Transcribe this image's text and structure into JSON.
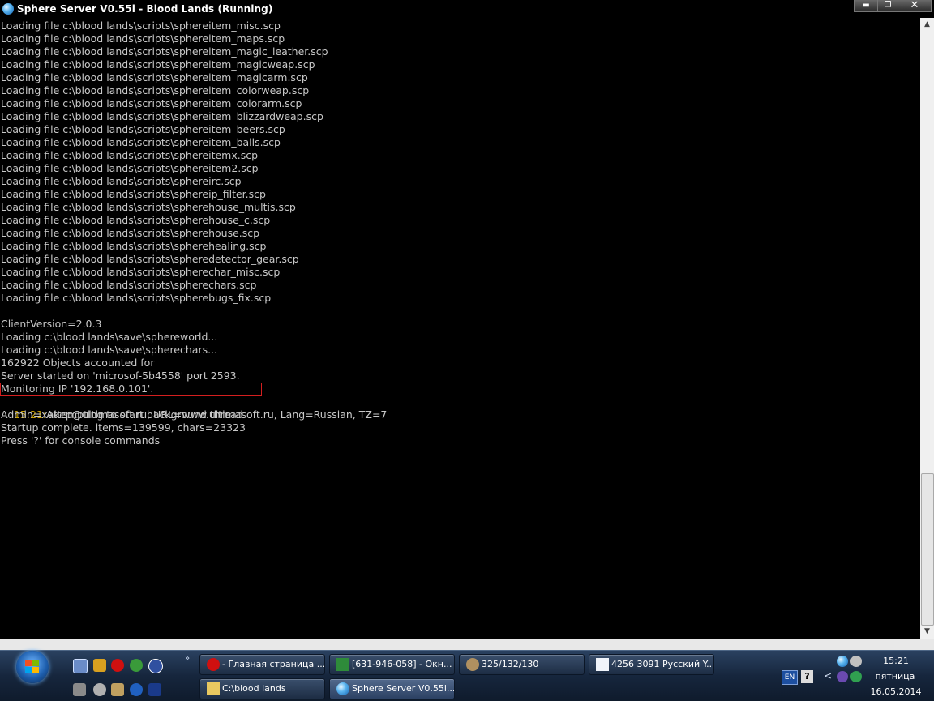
{
  "window": {
    "title": "Sphere Server V0.55i - Blood Lands (Running)",
    "controls": {
      "minimize": "▬",
      "maximize": "❐",
      "close": "✕"
    }
  },
  "console": {
    "lines": [
      "Loading file c:\\blood lands\\scripts\\sphereitem_misc.scp",
      "Loading file c:\\blood lands\\scripts\\sphereitem_maps.scp",
      "Loading file c:\\blood lands\\scripts\\sphereitem_magic_leather.scp",
      "Loading file c:\\blood lands\\scripts\\sphereitem_magicweap.scp",
      "Loading file c:\\blood lands\\scripts\\sphereitem_magicarm.scp",
      "Loading file c:\\blood lands\\scripts\\sphereitem_colorweap.scp",
      "Loading file c:\\blood lands\\scripts\\sphereitem_colorarm.scp",
      "Loading file c:\\blood lands\\scripts\\sphereitem_blizzardweap.scp",
      "Loading file c:\\blood lands\\scripts\\sphereitem_beers.scp",
      "Loading file c:\\blood lands\\scripts\\sphereitem_balls.scp",
      "Loading file c:\\blood lands\\scripts\\sphereitemx.scp",
      "Loading file c:\\blood lands\\scripts\\sphereitem2.scp",
      "Loading file c:\\blood lands\\scripts\\sphereirc.scp",
      "Loading file c:\\blood lands\\scripts\\sphereip_filter.scp",
      "Loading file c:\\blood lands\\scripts\\spherehouse_multis.scp",
      "Loading file c:\\blood lands\\scripts\\spherehouse_c.scp",
      "Loading file c:\\blood lands\\scripts\\spherehouse.scp",
      "Loading file c:\\blood lands\\scripts\\spherehealing.scp",
      "Loading file c:\\blood lands\\scripts\\spheredetector_gear.scp",
      "Loading file c:\\blood lands\\scripts\\spherechar_misc.scp",
      "Loading file c:\\blood lands\\scripts\\spherechars.scp",
      "Loading file c:\\blood lands\\scripts\\spherebugs_fix.scp",
      "",
      "ClientVersion=2.0.3",
      "Loading c:\\blood lands\\save\\sphereworld...",
      "Loading c:\\blood lands\\save\\spherechars...",
      "162922 Objects accounted for",
      "Server started on 'microsof-5b4558' port 2593.",
      "Monitoring IP '192.168.0.101'."
    ],
    "timestamp": "15:21:",
    "thread_message": "Attempting to start background thread",
    "tail_lines": [
      "Admin=xakep@ultimasoft.ru, URL=www.ultimasoft.ru, Lang=Russian, TZ=7",
      "Startup complete. items=139599, chars=23323",
      "Press '?' for console commands"
    ],
    "colors": {
      "text": "#c8c8c8",
      "timestamp": "#c8a000",
      "highlight": "#d41f1f"
    }
  },
  "scrollbar": {
    "up": "▲",
    "down": "▼"
  },
  "taskbar": {
    "quick_launch_chevron": "»",
    "tasks_row1": [
      {
        "icon": "opera-icon",
        "label": "- Главная страница ..."
      },
      {
        "icon": "spreadsheet-icon",
        "label": "[631-946-058] - Окн..."
      },
      {
        "icon": "bug-icon",
        "label": "325/132/130"
      },
      {
        "icon": "window-icon",
        "label": "4256 3091 Русский Y..."
      }
    ],
    "tasks_row2": [
      {
        "icon": "folder-icon",
        "label": "C:\\blood lands"
      },
      {
        "icon": "sphere-icon",
        "label": "Sphere Server V0.55i..."
      }
    ],
    "tray": {
      "language": "EN",
      "help": "?",
      "chevron": "<",
      "time": "15:21",
      "day": "пятница",
      "date": "16.05.2014"
    }
  }
}
